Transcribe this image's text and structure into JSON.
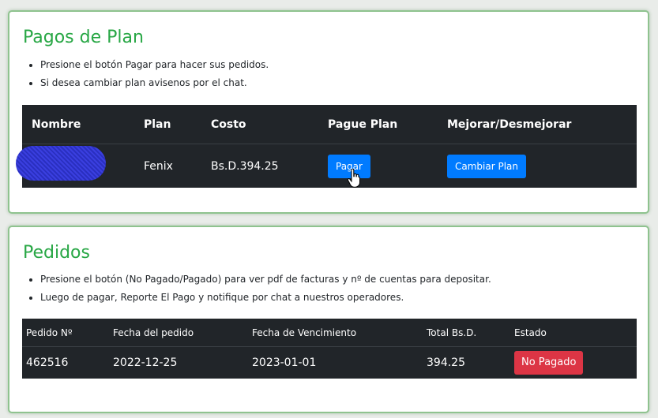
{
  "plan_section": {
    "title": "Pagos de Plan",
    "notes": [
      "Presione el botón Pagar para hacer sus pedidos.",
      "Si desea cambiar plan avisenos por el chat."
    ],
    "headers": [
      "Nombre",
      "Plan",
      "Costo",
      "Pague Plan",
      "Mejorar/Desmejorar"
    ],
    "row": {
      "nombre": "",
      "plan": "Fenix",
      "costo": "Bs.D.394.25",
      "pay_button": "Pagar",
      "change_button": "Cambiar Plan"
    }
  },
  "orders_section": {
    "title": "Pedidos",
    "notes": [
      "Presione el botón (No Pagado/Pagado) para ver pdf de facturas y nº de cuentas para depositar.",
      "Luego de pagar, Reporte El Pago y notifique por chat a nuestros operadores."
    ],
    "headers": [
      "Pedido Nº",
      "Fecha del pedido",
      "Fecha de Vencimiento",
      "Total Bs.D.",
      "Estado"
    ],
    "rows": [
      {
        "pedido": "462516",
        "fecha": "2022-12-25",
        "vencimiento": "2023-01-01",
        "total": "394.25",
        "estado": "No Pagado"
      }
    ]
  },
  "colors": {
    "title": "#28a745",
    "table_bg": "#212529",
    "primary": "#007bff",
    "danger": "#dc3545",
    "card_border": "#8fc38f"
  },
  "icons": {
    "cursor": "hand-pointer-cursor-icon",
    "redaction": "redacted-name-scribble"
  }
}
